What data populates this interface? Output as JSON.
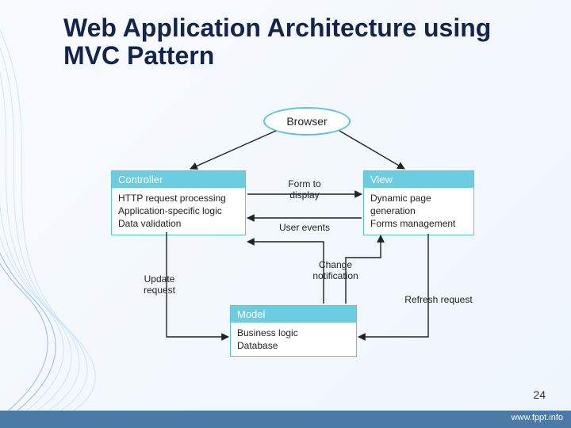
{
  "slide": {
    "title": "Web Application Architecture using MVC Pattern",
    "page_number": "24",
    "footer_link": "www.fppt.info"
  },
  "nodes": {
    "browser": {
      "label": "Browser"
    },
    "controller": {
      "header": "Controller",
      "body": "HTTP request processing\nApplication-specific logic\nData validation"
    },
    "view": {
      "header": "View",
      "body": "Dynamic page\ngeneration\nForms management"
    },
    "model": {
      "header": "Model",
      "body": "Business logic\nDatabase"
    }
  },
  "edges": {
    "form_to_display": "Form to\ndisplay",
    "user_events": "User events",
    "change_notification": "Change\nnotification",
    "update_request": "Update\nrequest",
    "refresh_request": "Refresh request"
  }
}
